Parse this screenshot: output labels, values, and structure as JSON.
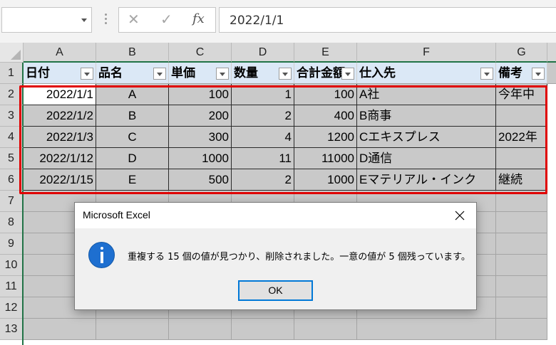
{
  "formula_bar": {
    "name_box": "",
    "cancel_icon": "x-icon",
    "enter_icon": "checkmark-icon",
    "fx_label": "fx",
    "content": "2022/1/1"
  },
  "columns": [
    "A",
    "B",
    "C",
    "D",
    "E",
    "F",
    "G"
  ],
  "rows": [
    "1",
    "2",
    "3",
    "4",
    "5",
    "6",
    "7",
    "8",
    "9",
    "10",
    "11",
    "12",
    "13"
  ],
  "table": {
    "headers": [
      "日付",
      "品名",
      "単価",
      "数量",
      "合計金額",
      "仕入先",
      "備考"
    ],
    "data": [
      [
        "2022/1/1",
        "A",
        "100",
        "1",
        "100",
        "A社",
        "今年中"
      ],
      [
        "2022/1/2",
        "B",
        "200",
        "2",
        "400",
        "B商事",
        ""
      ],
      [
        "2022/1/3",
        "C",
        "300",
        "4",
        "1200",
        "Cエキスプレス",
        "2022年"
      ],
      [
        "2022/1/12",
        "D",
        "1000",
        "11",
        "11000",
        "D通信",
        ""
      ],
      [
        "2022/1/15",
        "E",
        "500",
        "2",
        "1000",
        "Eマテリアル・インク",
        "継続"
      ]
    ]
  },
  "dialog": {
    "title": "Microsoft Excel",
    "icon": "info-icon",
    "message": "重複する 15 個の値が見つかり、削除されました。一意の値が 5 個残っています。",
    "ok_label": "OK"
  },
  "colors": {
    "highlight_border": "#e00000",
    "header_fill": "#dbe8f6",
    "selection_green": "#217346",
    "info_blue": "#1e6fd0"
  }
}
